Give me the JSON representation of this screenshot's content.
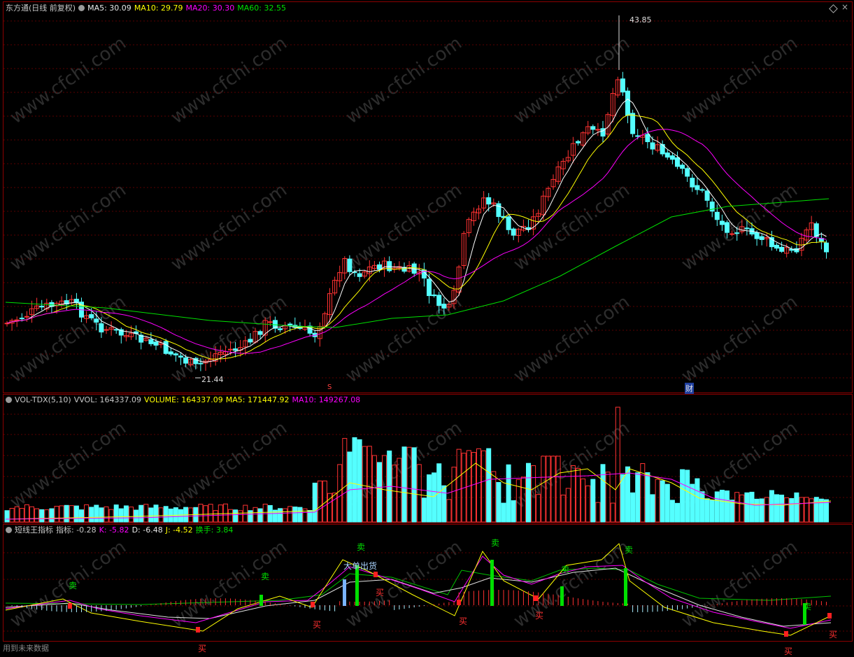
{
  "main_panel": {
    "title": "东方通(日线 前复权)",
    "ma5": "MA5: 30.09",
    "ma10": "MA10: 29.79",
    "ma20": "MA20: 30.30",
    "ma60": "MA60: 32.55",
    "high_label": "43.85",
    "low_label": "21.44",
    "marker_s": "S",
    "marker_cai": "财"
  },
  "volume_panel": {
    "name": "VOL-TDX(5,10)",
    "vvol": "VVOL: 164337.09",
    "volume": "VOLUME: 164337.09",
    "ma5": "MA5: 171447.92",
    "ma10": "MA10: 149267.08"
  },
  "indicator_panel": {
    "name": "短线王指标",
    "index": "指标: -0.28",
    "k": "K: -5.82",
    "d": "D: -6.48",
    "j": "J: -4.52",
    "turnover": "换手: 3.84",
    "sell_label": "卖",
    "buy_label": "买",
    "big_out": "大单出货"
  },
  "footer": "用到未来数据",
  "watermark": "www.cfchi.com",
  "colors": {
    "up": "#ff3232",
    "down": "#54ffff",
    "ma5": "#ffffff",
    "ma10": "#ffff00",
    "ma20": "#ff00ff",
    "ma60": "#00e000"
  },
  "chart_data": {
    "type": "candlestick",
    "price_high": 43.85,
    "price_low": 21.44,
    "ma_last": {
      "MA5": 30.09,
      "MA10": 29.79,
      "MA20": 30.3,
      "MA60": 32.55
    }
  }
}
